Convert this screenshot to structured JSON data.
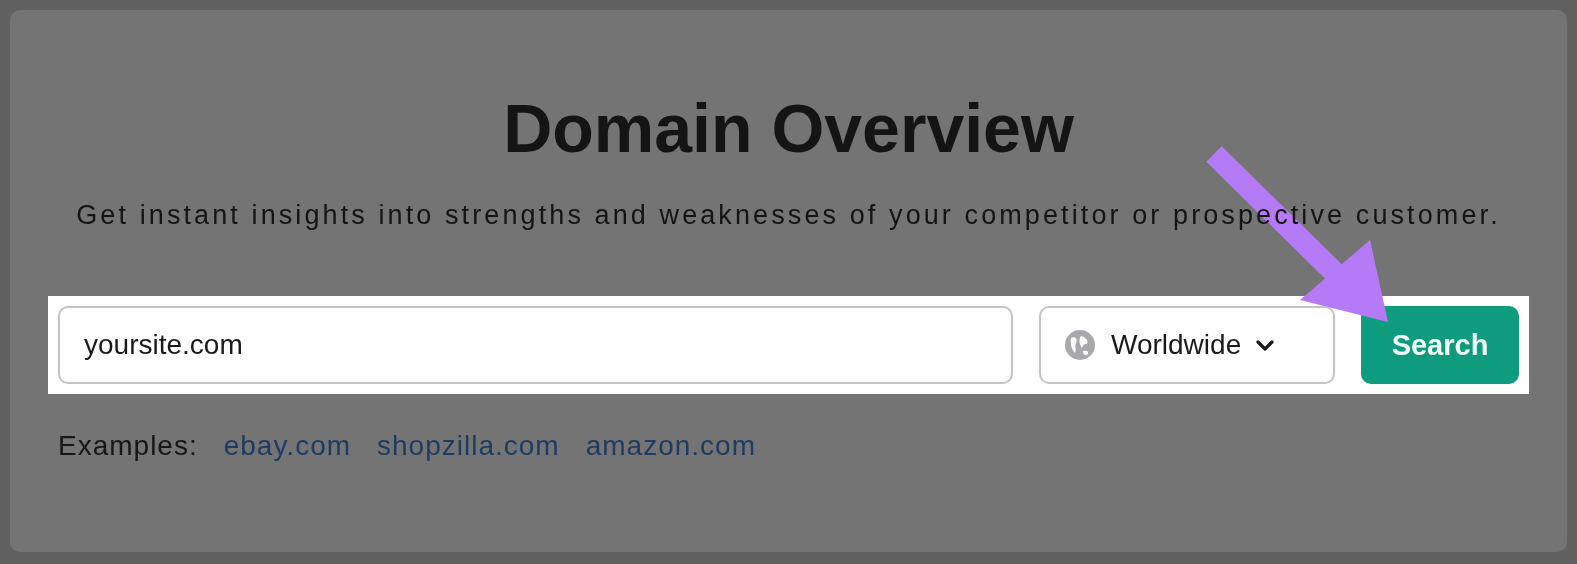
{
  "title": "Domain Overview",
  "subtitle": "Get instant insights into strengths and weaknesses of your competitor or prospective customer.",
  "search": {
    "value": "yoursite.com"
  },
  "region": {
    "label": "Worldwide"
  },
  "button": {
    "label": "Search"
  },
  "examples": {
    "label": "Examples:",
    "links": [
      "ebay.com",
      "shopzilla.com",
      "amazon.com"
    ]
  },
  "annotation": {
    "kind": "arrow",
    "color": "#b57bf7"
  }
}
